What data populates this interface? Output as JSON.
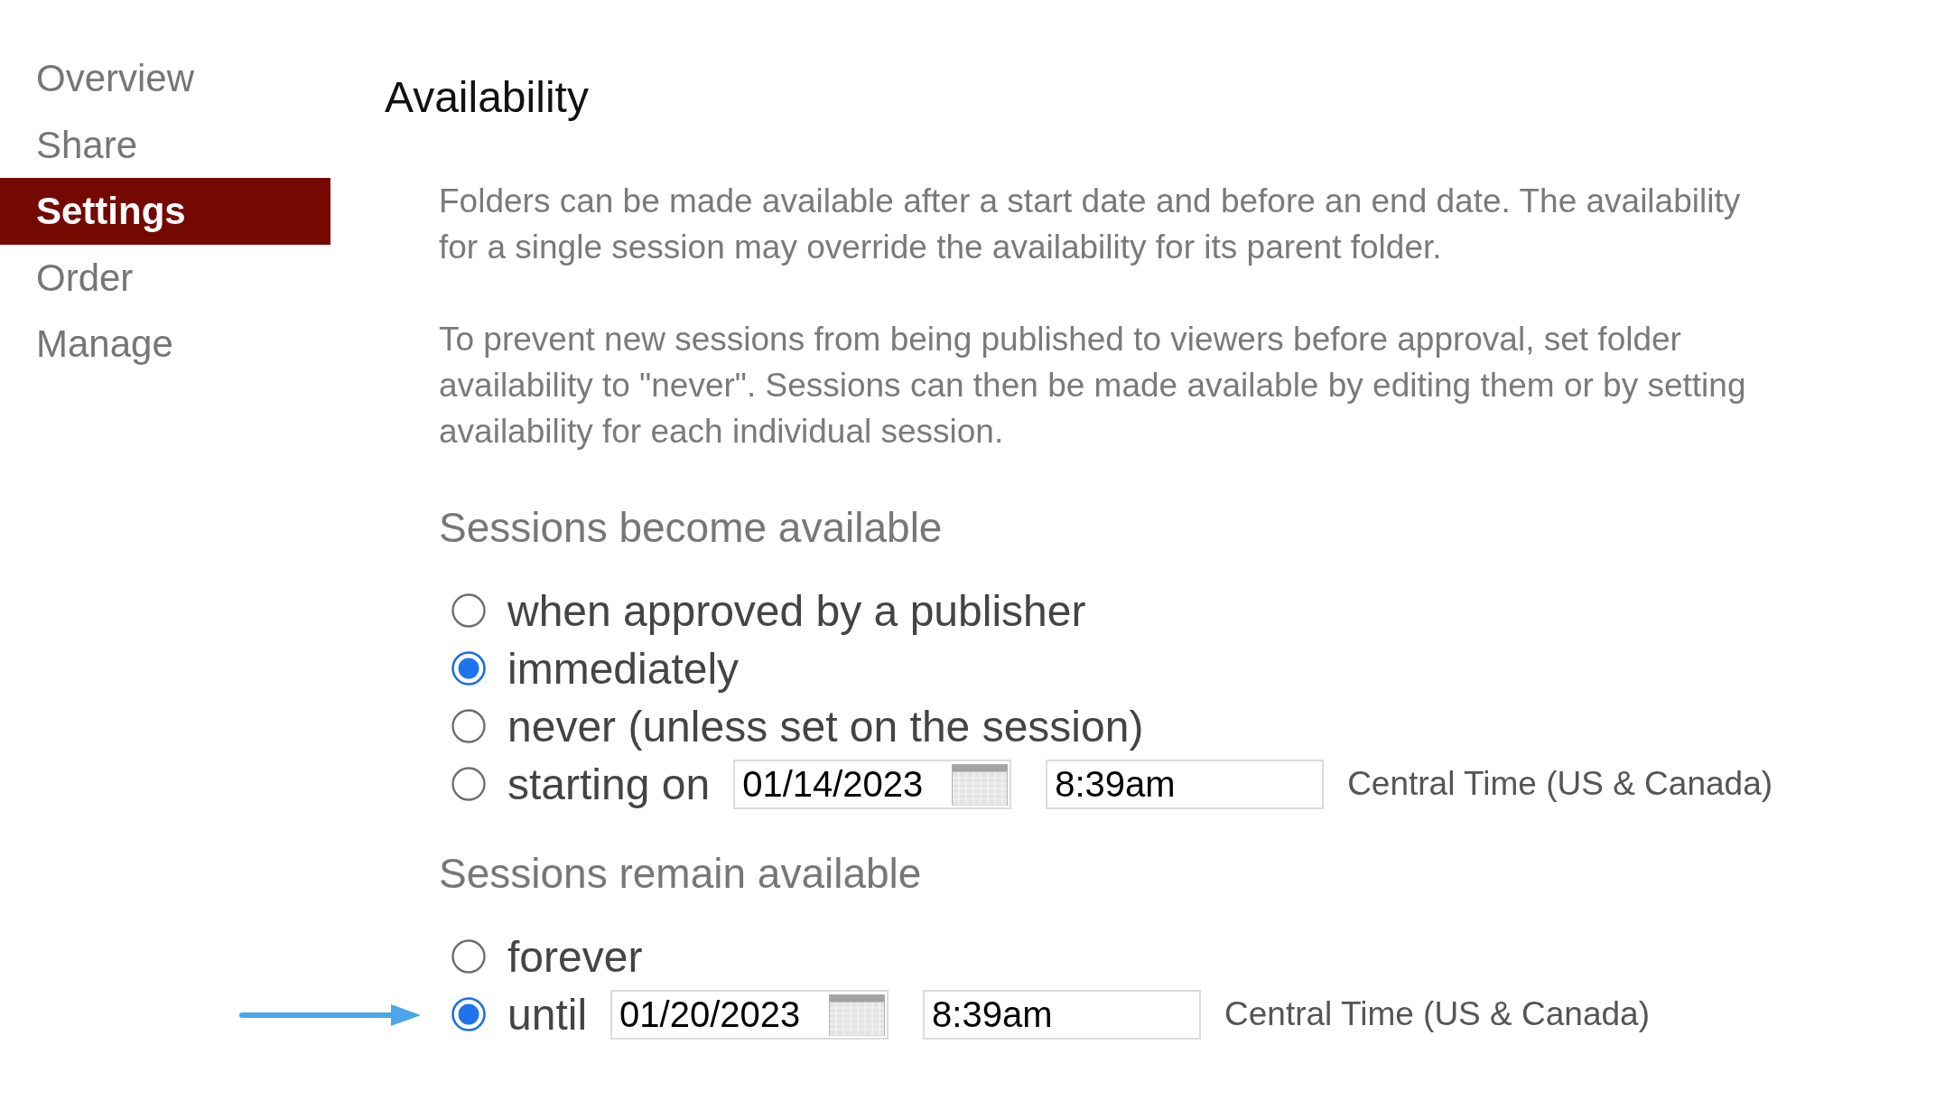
{
  "sidebar": {
    "items": [
      {
        "label": "Overview",
        "selected": false
      },
      {
        "label": "Share",
        "selected": false
      },
      {
        "label": "Settings",
        "selected": true
      },
      {
        "label": "Order",
        "selected": false
      },
      {
        "label": "Manage",
        "selected": false
      }
    ]
  },
  "page": {
    "title": "Availability",
    "description": [
      "Folders can be made available after a start date and before an end date. The availability for a single session may override the availability for its parent folder.",
      "To prevent new sessions from being published to viewers before approval, set folder availability to \"never\". Sessions can then be made available by editing them or by setting availability for each individual session."
    ]
  },
  "groups": [
    {
      "heading": "Sessions become available",
      "options": [
        {
          "kind": "plain",
          "label": "when approved by a publisher",
          "selected": false,
          "arrow": false
        },
        {
          "kind": "plain",
          "label": "immediately",
          "selected": true,
          "arrow": false
        },
        {
          "kind": "plain",
          "label": "never (unless set on the session)",
          "selected": false,
          "arrow": false
        },
        {
          "kind": "datetime",
          "label": "starting on",
          "selected": false,
          "arrow": false,
          "date": "01/14/2023",
          "time": "8:39am",
          "timezone": "Central Time (US & Canada)"
        }
      ]
    },
    {
      "heading": "Sessions remain available",
      "options": [
        {
          "kind": "plain",
          "label": "forever",
          "selected": false,
          "arrow": false
        },
        {
          "kind": "datetime",
          "label": "until",
          "selected": true,
          "arrow": true,
          "date": "01/20/2023",
          "time": "8:39am",
          "timezone": "Central Time (US & Canada)"
        }
      ]
    }
  ]
}
